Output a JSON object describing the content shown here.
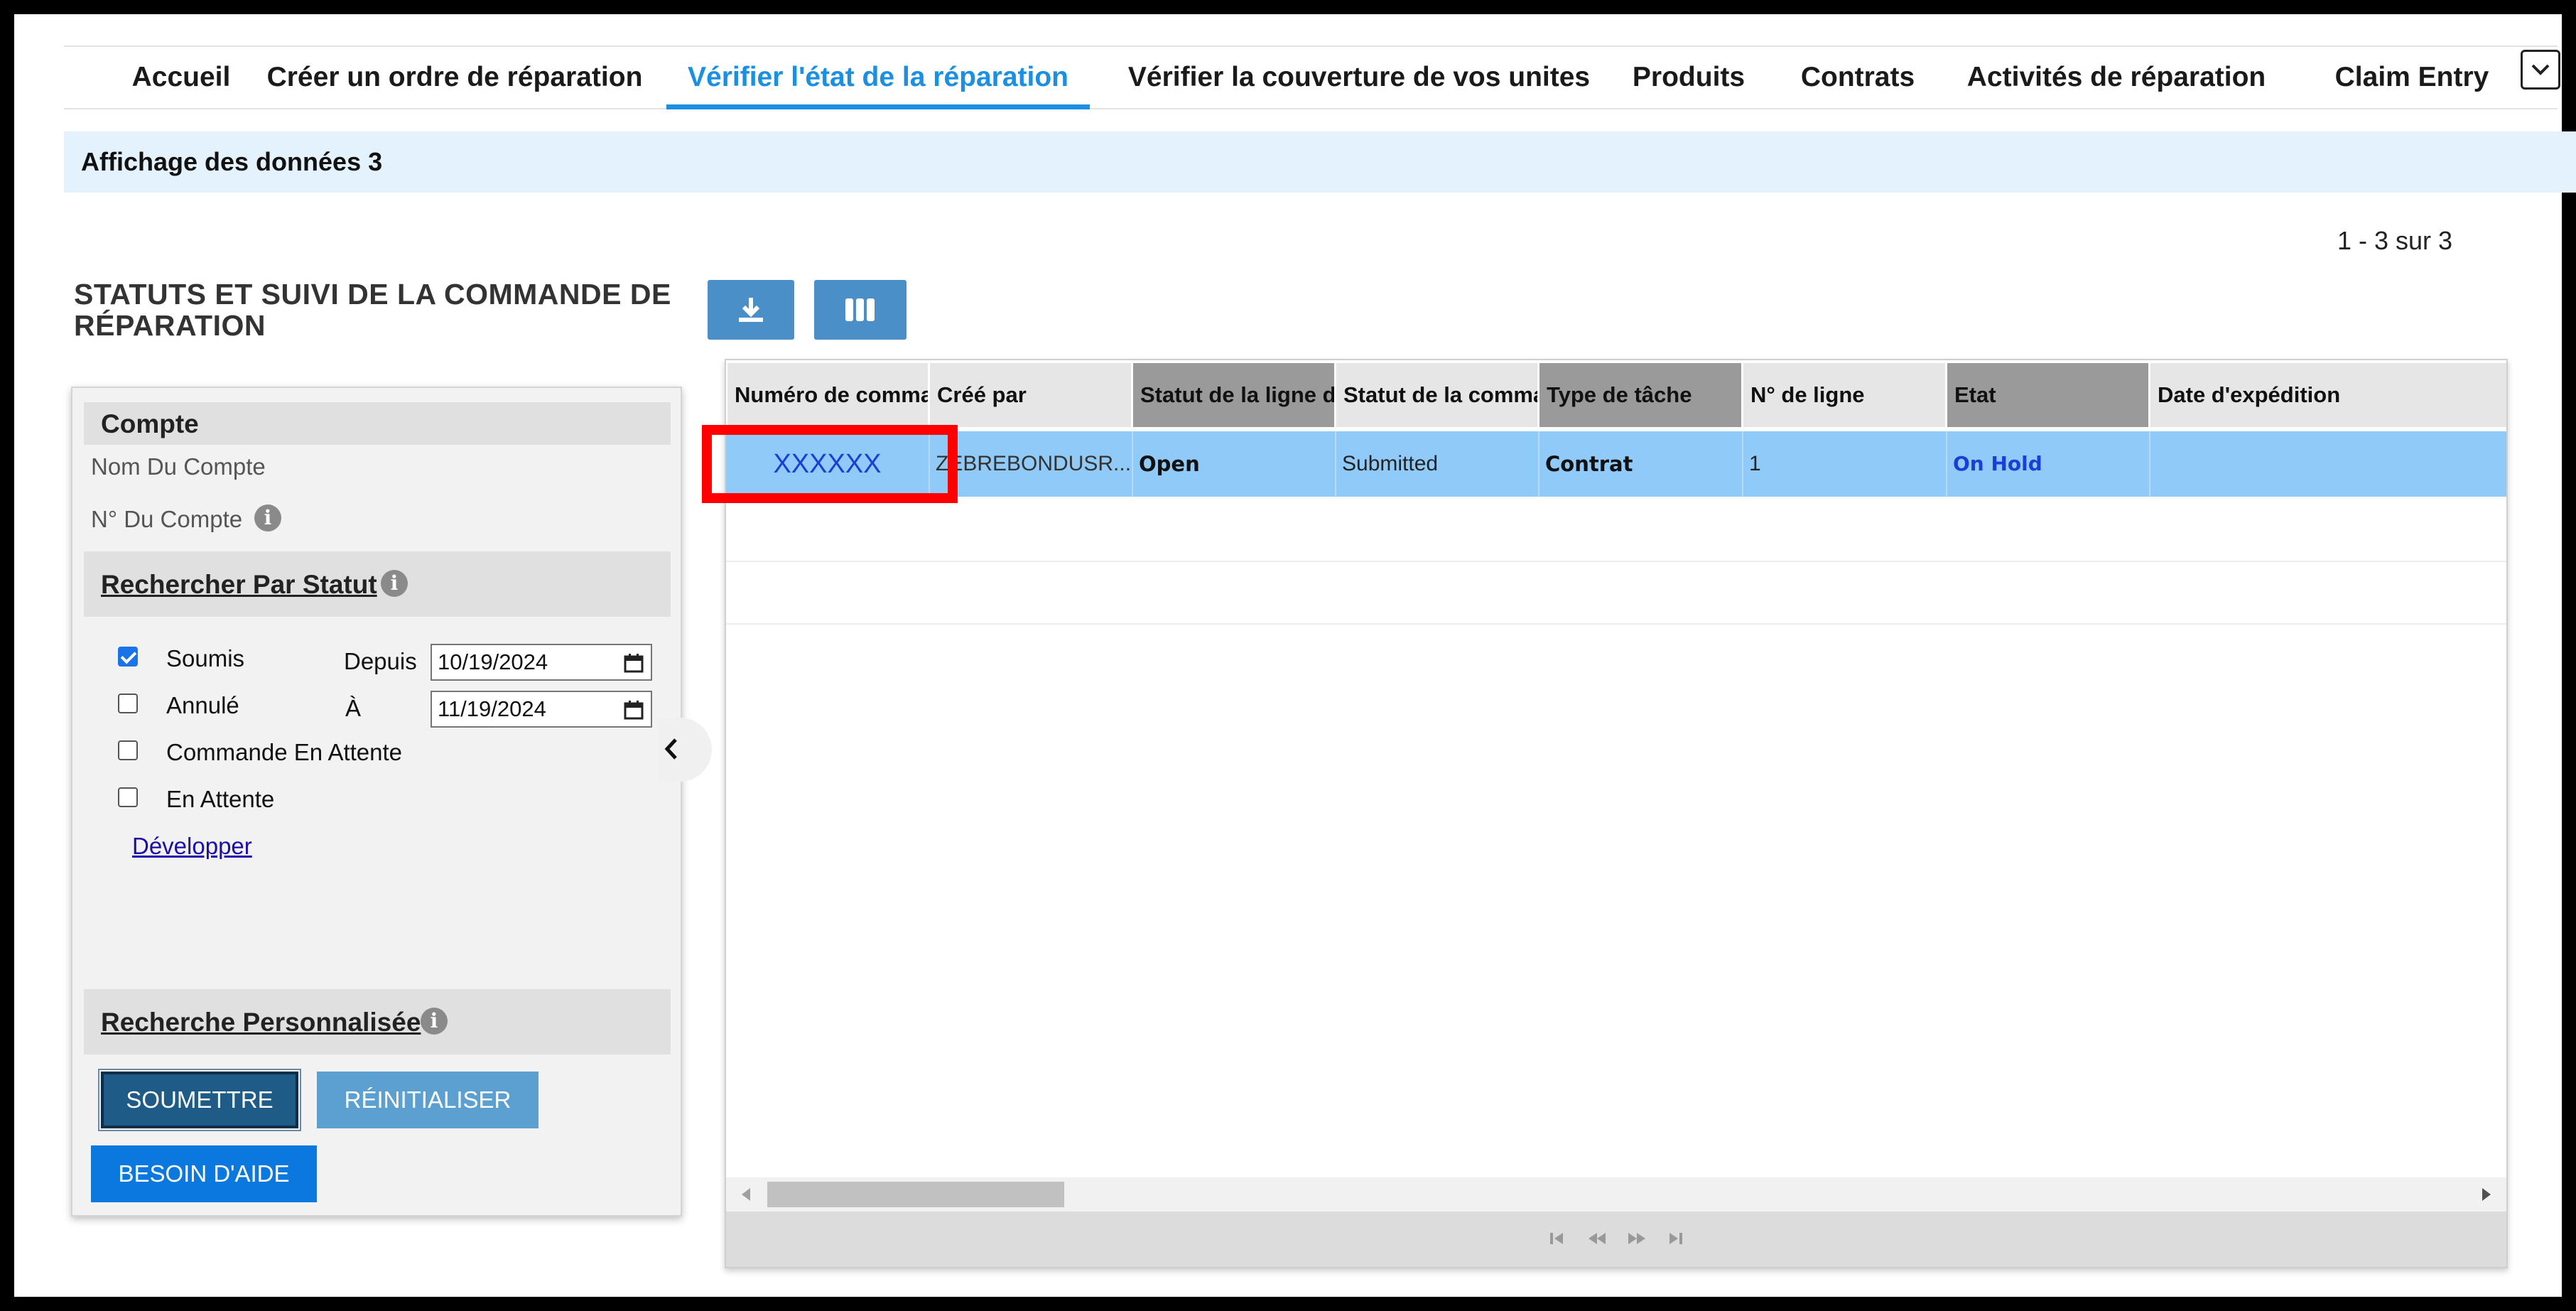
{
  "nav": {
    "tabs": [
      {
        "label": "Accueil",
        "active": false
      },
      {
        "label": "Créer un ordre de réparation",
        "active": false
      },
      {
        "label": "Vérifier l'état de la réparation",
        "active": true
      },
      {
        "label": "Vérifier la couverture de vos unites",
        "active": false
      },
      {
        "label": "Produits",
        "active": false
      },
      {
        "label": "Contrats",
        "active": false
      },
      {
        "label": "Activités de réparation",
        "active": false
      },
      {
        "label": "Claim Entry",
        "active": false
      }
    ],
    "more_icon": "chevron-down-icon"
  },
  "banner": {
    "text": "Affichage des données 3"
  },
  "pager": {
    "summary": "1 - 3 sur 3"
  },
  "panel": {
    "title": "STATUTS ET SUIVI DE LA COMMANDE DE RÉPARATION",
    "account": {
      "header": "Compte",
      "name_label": "Nom Du Compte",
      "number_label": "N° Du Compte"
    },
    "status_search": {
      "header": "Rechercher Par Statut",
      "options": [
        {
          "label": "Soumis",
          "checked": true
        },
        {
          "label": "Annulé",
          "checked": false
        },
        {
          "label": "Commande En Attente",
          "checked": false
        },
        {
          "label": "En Attente",
          "checked": false
        }
      ],
      "from_label": "Depuis",
      "from_value": "10/19/2024",
      "to_label": "À",
      "to_value": "11/19/2024",
      "expand_link": "Développer"
    },
    "custom_search": {
      "header": "Recherche Personnalisée"
    },
    "buttons": {
      "submit": "SOUMETTRE",
      "reset": "RÉINITIALISER",
      "help": "BESOIN D'AIDE"
    }
  },
  "toolbar": {
    "download_icon": "download-icon",
    "columns_icon": "columns-icon"
  },
  "grid": {
    "columns": [
      "Numéro de commande",
      "Créé par",
      "Statut de la ligne de commande",
      "Statut de la commande",
      "Type de tâche",
      "N° de ligne",
      "Etat",
      "Date d'expédition"
    ],
    "rows": [
      {
        "order_number": "XXXXXX",
        "created_by": "ZEBREBONDUSR...",
        "line_status": "Open",
        "order_status": "Submitted",
        "task_type": "Contrat",
        "line_no": "1",
        "state": "On Hold",
        "ship_date": ""
      }
    ]
  },
  "colors": {
    "accent": "#1a8fe3",
    "row_highlight": "#90caf9",
    "banner": "#e3f2fd",
    "callout": "#ff0000"
  }
}
